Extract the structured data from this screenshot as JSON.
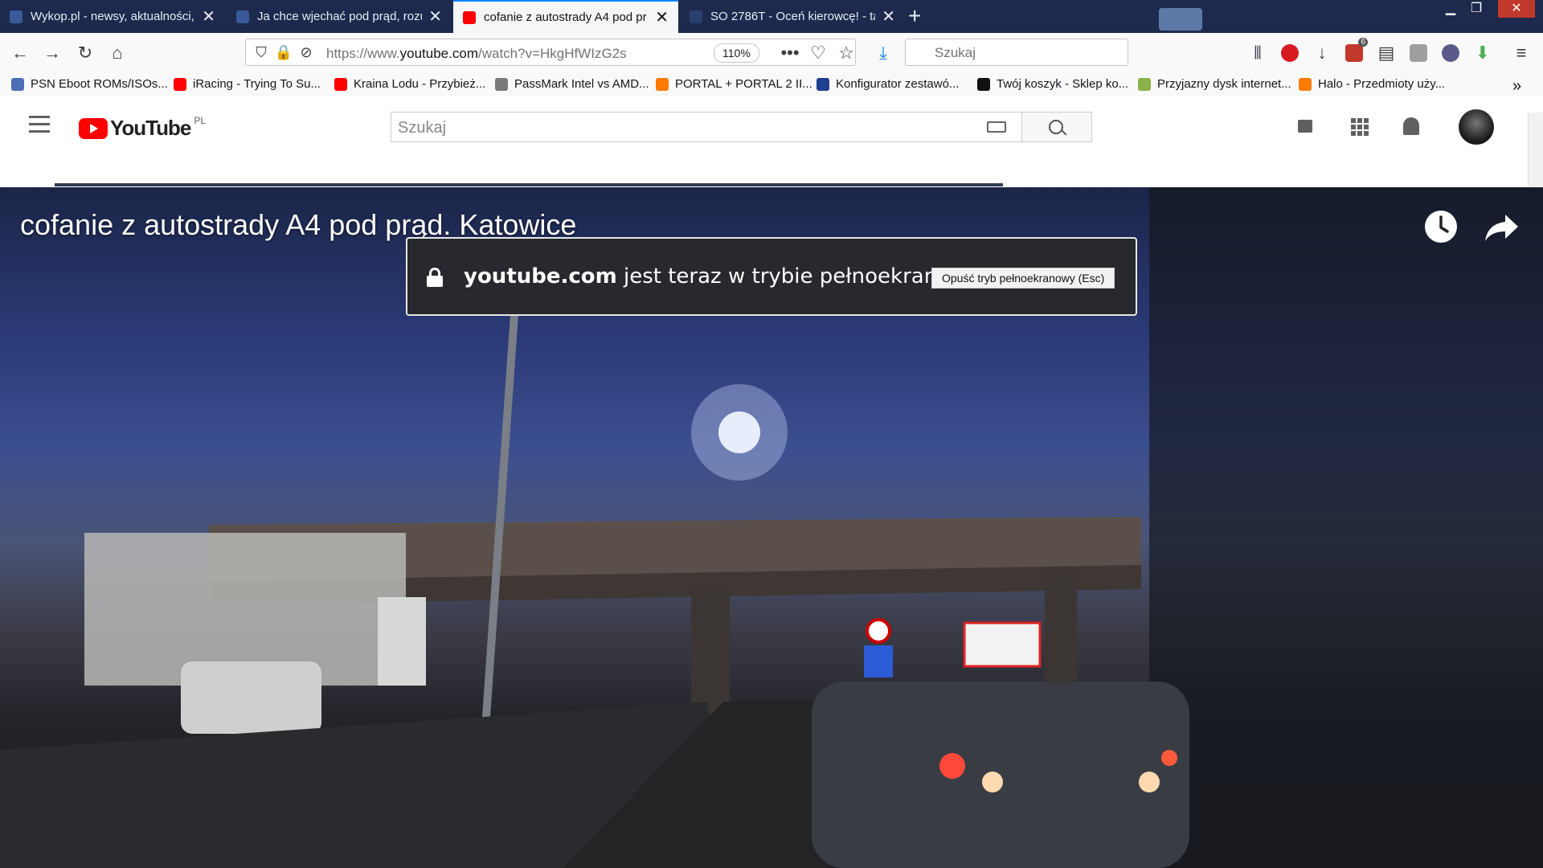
{
  "browser": {
    "tabs": [
      {
        "title": "Wykop.pl - newsy, aktualności,",
        "favicon_color": "#3a5a9b"
      },
      {
        "title": "Ja chce wjechać pod prąd, rozu",
        "favicon_color": "#3a5a9b"
      },
      {
        "title": "cofanie z autostrady A4 pod pr",
        "favicon_color": "#ff0000"
      },
      {
        "title": "SO 2786T - Oceń kierowcę! - ta",
        "favicon_color": "#2a3f6e"
      }
    ],
    "url_prefix": "https://www.",
    "url_domain": "youtube.com",
    "url_path": "/watch?v=HkgHfWIzG2s",
    "zoom": "110%",
    "search_placeholder": "Szukaj",
    "adblock_count": "6",
    "bookmarks": [
      {
        "label": "PSN Eboot ROMs/ISOs...",
        "icon_color": "#4a6fb5"
      },
      {
        "label": "iRacing - Trying To Su...",
        "icon_color": "#ff0000"
      },
      {
        "label": "Kraina Lodu - Przybież...",
        "icon_color": "#ff0000"
      },
      {
        "label": "PassMark Intel vs AMD...",
        "icon_color": "#7a7a7a"
      },
      {
        "label": "PORTAL + PORTAL 2 II...",
        "icon_color": "#ff7a00"
      },
      {
        "label": "Konfigurator zestawó...",
        "icon_color": "#1f3f8f"
      },
      {
        "label": "Twój koszyk - Sklep ko...",
        "icon_color": "#111111"
      },
      {
        "label": "Przyjazny dysk internet...",
        "icon_color": "#8bb34a"
      },
      {
        "label": "Halo - Przedmioty uży...",
        "icon_color": "#ff7a00"
      }
    ]
  },
  "youtube": {
    "logo_text": "YouTube",
    "region": "PL",
    "search_placeholder": "Szukaj",
    "video_title": "cofanie z autostrady A4 pod prąd. Katowice",
    "fullscreen_domain": "youtube.com",
    "fullscreen_msg": " jest teraz w trybie pełnoekranowym",
    "exit_fullscreen_label": "Opuść tryb pełnoekranowy (Esc)",
    "brand_color": "#ff0000"
  }
}
